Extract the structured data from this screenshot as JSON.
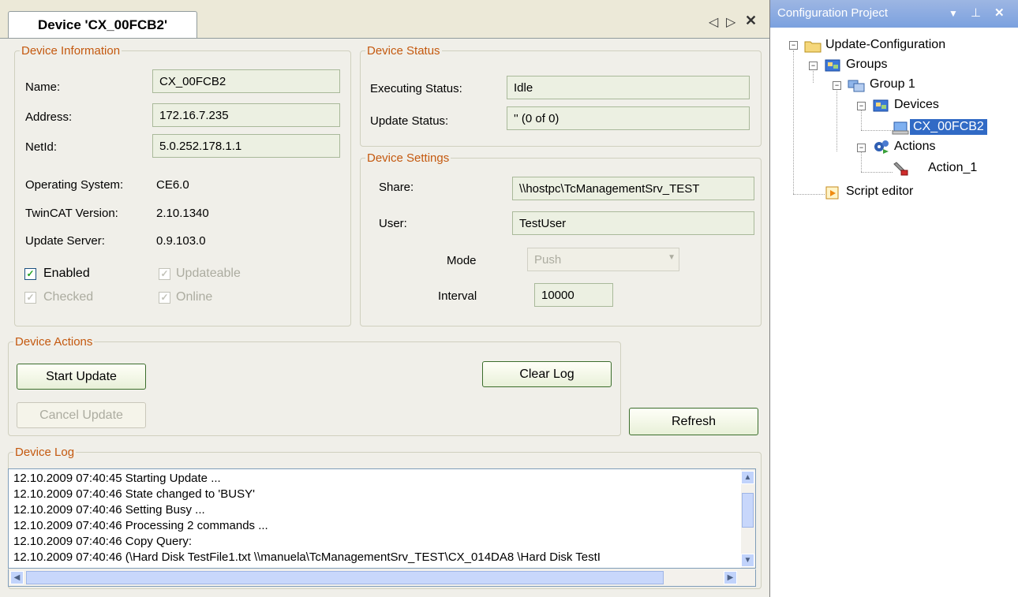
{
  "tab": {
    "title": "Device 'CX_00FCB2'"
  },
  "device_information": {
    "legend": "Device Information",
    "name_label": "Name:",
    "name_value": "CX_00FCB2",
    "address_label": "Address:",
    "address_value": "172.16.7.235",
    "netid_label": "NetId:",
    "netid_value": "5.0.252.178.1.1",
    "os_label": "Operating System:",
    "os_value": "CE6.0",
    "twincat_label": "TwinCAT Version:",
    "twincat_value": "2.10.1340",
    "update_server_label": "Update Server:",
    "update_server_value": "0.9.103.0",
    "enabled_label": "Enabled",
    "updateable_label": "Updateable",
    "checked_label": "Checked",
    "online_label": "Online"
  },
  "device_status": {
    "legend": "Device Status",
    "exec_label": "Executing Status:",
    "exec_value": "Idle",
    "update_label": "Update Status:",
    "update_value": "'' (0 of 0)"
  },
  "device_settings": {
    "legend": "Device Settings",
    "share_label": "Share:",
    "share_value": "\\\\hostpc\\TcManagementSrv_TEST",
    "user_label": "User:",
    "user_value": "TestUser",
    "mode_label": "Mode",
    "mode_value": "Push",
    "interval_label": "Interval",
    "interval_value": "10000"
  },
  "device_actions": {
    "legend": "Device Actions",
    "start_update": "Start Update",
    "cancel_update": "Cancel Update",
    "clear_log": "Clear Log",
    "refresh": "Refresh"
  },
  "device_log": {
    "legend": "Device Log",
    "lines": [
      "12.10.2009 07:40:45 Starting Update ...",
      "12.10.2009 07:40:46 State changed to 'BUSY'",
      "12.10.2009 07:40:46 Setting Busy ...",
      "12.10.2009 07:40:46 Processing 2 commands ...",
      "12.10.2009 07:40:46 Copy Query:",
      "12.10.2009 07:40:46 (\\Hard Disk TestFile1.txt \\\\manuela\\TcManagementSrv_TEST\\CX_014DA8 \\Hard Disk TestI"
    ]
  },
  "panel": {
    "title": "Configuration Project",
    "tree": {
      "root": "Update-Configuration",
      "groups": "Groups",
      "group1": "Group 1",
      "devices": "Devices",
      "device": "CX_00FCB2",
      "actions": "Actions",
      "action1": "Action_1",
      "script_editor": "Script editor"
    }
  },
  "colors": {
    "legend": "#c4590f",
    "panel_header": "#7ba1df",
    "selected": "#316ac5"
  }
}
